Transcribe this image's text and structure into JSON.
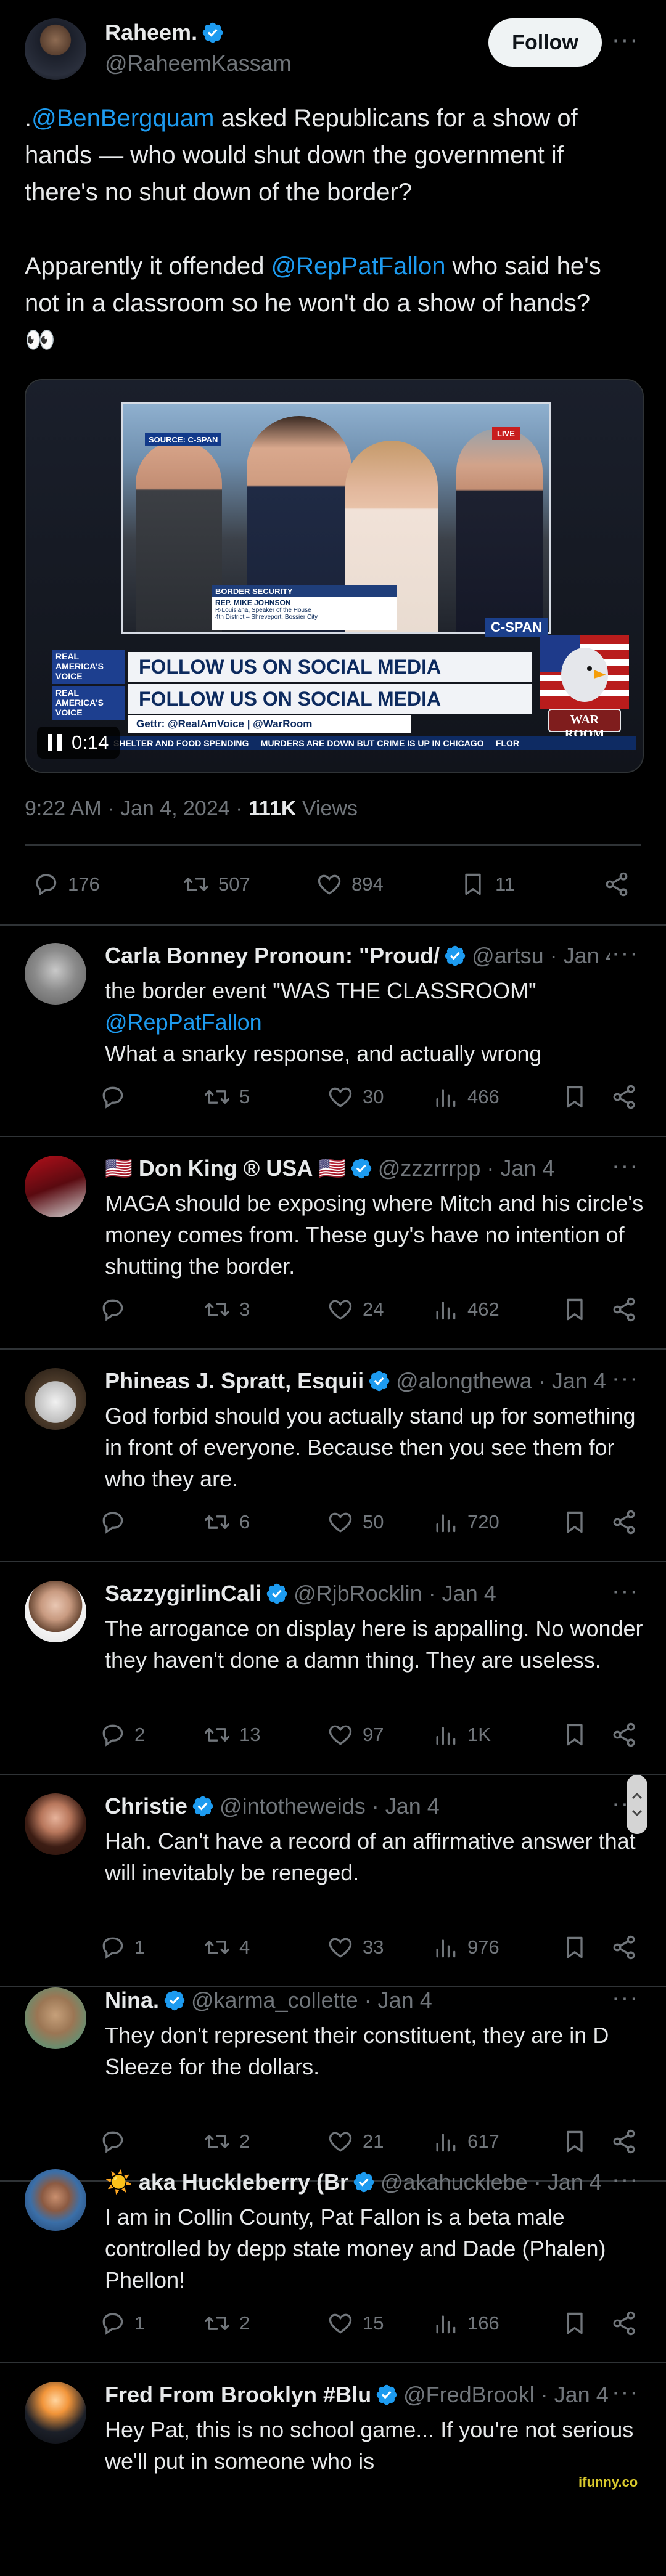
{
  "main_tweet": {
    "author_name": "Raheem.",
    "author_handle": "@RaheemKassam",
    "follow_label": "Follow",
    "mention_1": "@BenBergquam",
    "text_1_prefix": ".",
    "text_1_rest": " asked Republicans for a show of hands — who would shut down the government if there's no shut down of the border?",
    "text_2_prefix": "Apparently it offended ",
    "mention_2": "@RepPatFallon",
    "text_2_rest": " who said he's not in a classroom so he won't do a show of hands?",
    "emoji": "👀",
    "video": {
      "duration": "0:14",
      "source_tag": "SOURCE: C-SPAN",
      "live_tag": "LIVE",
      "lower_third_title": "BORDER SECURITY",
      "lower_third_name": "REP. MIKE JOHNSON",
      "lower_third_detail_1": "R-Louisiana, Speaker of the House",
      "lower_third_detail_2": "4th District – Shreveport, Bossier City",
      "network": "C-SPAN",
      "banner_1": "FOLLOW US ON SOCIAL MEDIA",
      "banner_2": "FOLLOW US ON SOCIAL MEDIA",
      "gettr": "Gettr: @RealAmVoice | @WarRoom",
      "ticker": "SHELTER AND FOOD SPENDING     MURDERS ARE DOWN BUT CRIME IS UP IN CHICAGO     FLOR",
      "brand_1": "REAL AMERICA'S VOICE",
      "brand_2": "REAL AMERICA'S VOICE",
      "warroom": "WAR ROOM"
    },
    "time": "9:22 AM · Jan 4, 2024 · ",
    "views_count": "111K",
    "views_label": " Views",
    "replies": "176",
    "reposts": "507",
    "likes": "894",
    "bookmarks": "11"
  },
  "replies": [
    {
      "name": "Carla Bonney Pronoun: \"Proud/",
      "verified": true,
      "handle": "@artsu",
      "date": " · Jan 4",
      "mention": "",
      "text": "the border event \"WAS THE CLASSROOM\"",
      "mention_line": "@RepPatFallon",
      "text_2": "What a snarky response, and actually wrong",
      "replies": "",
      "reposts": "5",
      "likes": "30",
      "views": "466"
    },
    {
      "name": "🇺🇸 Don King ® USA 🇺🇸",
      "verified": true,
      "handle": "@zzzrrrpp",
      "date": " · Jan 4",
      "text": "MAGA should be exposing where Mitch and his circle's money comes from. These guy's have no intention of shutting the border.",
      "replies": "",
      "reposts": "3",
      "likes": "24",
      "views": "462"
    },
    {
      "name": "Phineas J. Spratt, Esquii",
      "verified": true,
      "handle": "@alongthewa",
      "date": " · Jan 4",
      "text": "God forbid should you actually stand up for something in front of everyone. Because then you see them for who they are.",
      "replies": "",
      "reposts": "6",
      "likes": "50",
      "views": "720"
    },
    {
      "name": "SazzygirlinCali",
      "verified": true,
      "handle": "@RjbRocklin",
      "date": " · Jan 4",
      "text": "The arrogance on display here is appalling. No wonder they haven't done a damn thing. They are useless.",
      "replies": "2",
      "reposts": "13",
      "likes": "97",
      "views": "1K"
    },
    {
      "name": "Christie",
      "verified": true,
      "handle": "@intotheweids",
      "date": " · Jan 4",
      "text": "Hah. Can't have a record of an affirmative answer that will inevitably be reneged.",
      "replies": "1",
      "reposts": "4",
      "likes": "33",
      "views": "976"
    },
    {
      "name": "Nina.",
      "verified": true,
      "handle": "@karma_collette",
      "date": " · Jan 4",
      "text": "They don't represent their constituent, they are in D Sleeze for the dollars.",
      "replies": "",
      "reposts": "2",
      "likes": "21",
      "views": "617"
    },
    {
      "name": "☀️ aka Huckleberry (Br",
      "verified": true,
      "handle": "@akahucklebe",
      "date": " · Jan 4",
      "text": "I am in Collin County,  Pat Fallon is a beta male controlled by depp state money and Dade (Phalen) Phellon!",
      "replies": "1",
      "reposts": "2",
      "likes": "15",
      "views": "166"
    },
    {
      "name": "Fred From Brooklyn #Blu",
      "verified": true,
      "handle": "@FredBrookl",
      "date": " · Jan 4",
      "text": "Hey Pat, this is no school game... If you're not serious we'll put in someone who is"
    }
  ],
  "watermark": "ifunny.co",
  "colors": {
    "background": "#000000",
    "text": "#e7e9ea",
    "muted": "#71767b",
    "link": "#1d9bf0",
    "divider": "#2f3336"
  }
}
